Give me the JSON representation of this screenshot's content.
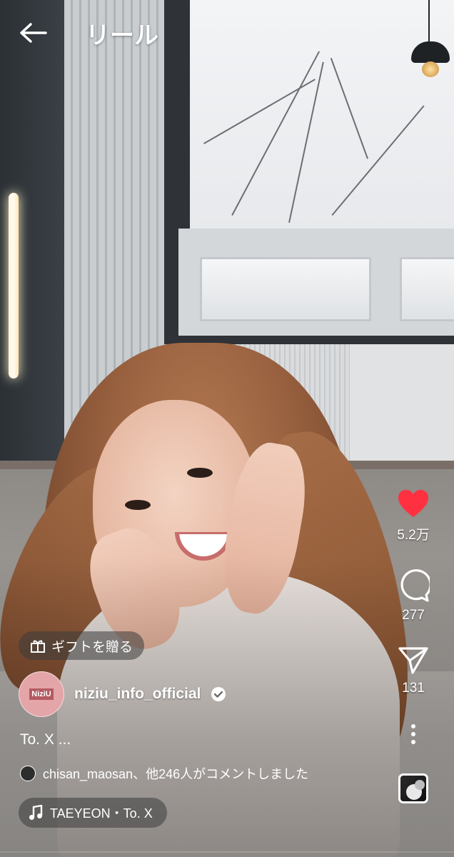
{
  "header": {
    "title": "リール"
  },
  "actions": {
    "likes": "5.2万",
    "comments": "277",
    "shares": "131"
  },
  "gift": {
    "label": "ギフトを贈る"
  },
  "author": {
    "avatar_text": "NiziU",
    "username": "niziu_info_official"
  },
  "caption": {
    "text": "To. X ..."
  },
  "comments_preview": {
    "text": "chisan_maosan、他246人がコメントしました"
  },
  "audio": {
    "label": "TAEYEON・To. X"
  },
  "colors": {
    "like": "#ff3040",
    "text": "#ffffff"
  }
}
